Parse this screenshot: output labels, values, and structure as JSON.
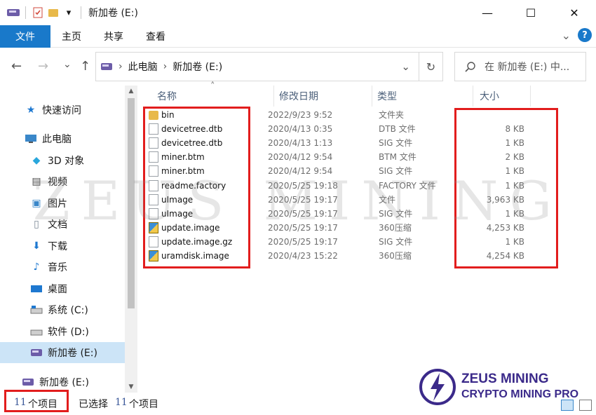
{
  "titlebar": {
    "title": "新加卷 (E:)",
    "dropdown_glyph": "▾",
    "min": "—",
    "max": "☐",
    "close": "✕"
  },
  "ribbon": {
    "tabs": [
      "文件",
      "主页",
      "共享",
      "查看"
    ],
    "expand_glyph": "⌄",
    "help": "?"
  },
  "address": {
    "back": "←",
    "forward": "→",
    "recent": "⌄",
    "up": "↑",
    "sep": "›",
    "crumbs": [
      "此电脑",
      "新加卷 (E:)"
    ],
    "history": "⌄",
    "refresh": "↻",
    "search_placeholder": "在 新加卷 (E:) 中..."
  },
  "sidebar": {
    "items": [
      {
        "label": "快速访问",
        "icon": "star-icon",
        "glyph": "★",
        "color": "#1e78d0"
      },
      {
        "label": "此电脑",
        "icon": "computer-icon",
        "glyph": "💻",
        "color": "#3a87c9"
      },
      {
        "label": "3D 对象",
        "icon": "cube-icon",
        "glyph": "◆",
        "color": "#29a7dc"
      },
      {
        "label": "视频",
        "icon": "video-icon",
        "glyph": "▤",
        "color": "#4a4a4a"
      },
      {
        "label": "图片",
        "icon": "picture-icon",
        "glyph": "▣",
        "color": "#3a87c9"
      },
      {
        "label": "文档",
        "icon": "document-icon",
        "glyph": "▯",
        "color": "#7a8796"
      },
      {
        "label": "下载",
        "icon": "download-icon",
        "glyph": "⬇",
        "color": "#1e78d0"
      },
      {
        "label": "音乐",
        "icon": "music-icon",
        "glyph": "♪",
        "color": "#1e78d0"
      },
      {
        "label": "桌面",
        "icon": "desktop-icon",
        "glyph": "▬",
        "color": "#1e78d0"
      },
      {
        "label": "系统 (C:)",
        "icon": "drive-icon",
        "glyph": "▭",
        "color": "#6a6a6a"
      },
      {
        "label": "软件 (D:)",
        "icon": "drive-icon",
        "glyph": "▭",
        "color": "#6a6a6a"
      },
      {
        "label": "新加卷 (E:)",
        "icon": "sd-drive-icon",
        "glyph": "◪",
        "color": "#7b6ab3"
      },
      {
        "label": "新加卷 (E:)",
        "icon": "sd-drive-icon",
        "glyph": "◪",
        "color": "#7b6ab3"
      }
    ],
    "scroll_up": "▲",
    "scroll_down": "▼"
  },
  "columns": {
    "name": "名称",
    "date": "修改日期",
    "type": "类型",
    "size": "大小",
    "sort_glyph": "˄"
  },
  "files": [
    {
      "name": "bin",
      "date": "2022/9/23 9:52",
      "type": "文件夹",
      "size": "",
      "icon": "folder-icon"
    },
    {
      "name": "devicetree.dtb",
      "date": "2020/4/13 0:35",
      "type": "DTB 文件",
      "size": "8 KB",
      "icon": "file-icon"
    },
    {
      "name": "devicetree.dtb",
      "date": "2020/4/13 1:13",
      "type": "SIG 文件",
      "size": "1 KB",
      "icon": "file-icon"
    },
    {
      "name": "miner.btm",
      "date": "2020/4/12 9:54",
      "type": "BTM 文件",
      "size": "2 KB",
      "icon": "file-icon"
    },
    {
      "name": "miner.btm",
      "date": "2020/4/12 9:54",
      "type": "SIG 文件",
      "size": "1 KB",
      "icon": "file-icon"
    },
    {
      "name": "readme.factory",
      "date": "2020/5/25 19:18",
      "type": "FACTORY 文件",
      "size": "1 KB",
      "icon": "file-icon"
    },
    {
      "name": "uImage",
      "date": "2020/5/25 19:17",
      "type": "文件",
      "size": "3,963 KB",
      "icon": "file-icon"
    },
    {
      "name": "uImage",
      "date": "2020/5/25 19:17",
      "type": "SIG 文件",
      "size": "1 KB",
      "icon": "file-icon"
    },
    {
      "name": "update.image",
      "date": "2020/5/25 19:17",
      "type": "360压缩",
      "size": "4,253 KB",
      "icon": "archive-icon"
    },
    {
      "name": "update.image.gz",
      "date": "2020/5/25 19:17",
      "type": "SIG 文件",
      "size": "1 KB",
      "icon": "file-icon"
    },
    {
      "name": "uramdisk.image",
      "date": "2020/4/23 15:22",
      "type": "360压缩",
      "size": "4,254 KB",
      "icon": "archive-icon"
    }
  ],
  "watermark": "ZEUS MINING",
  "status": {
    "count_num": "11",
    "count_label": "个项目",
    "selected_prefix": "已选择",
    "selected_num": "11",
    "selected_label": "个项目"
  },
  "logo": {
    "line1": "ZEUS MINING",
    "line2": "CRYPTO MINING PRO"
  },
  "colors": {
    "accent": "#1979ca",
    "highlight_box": "#e21d1d",
    "logo": "#3b2a8a"
  }
}
